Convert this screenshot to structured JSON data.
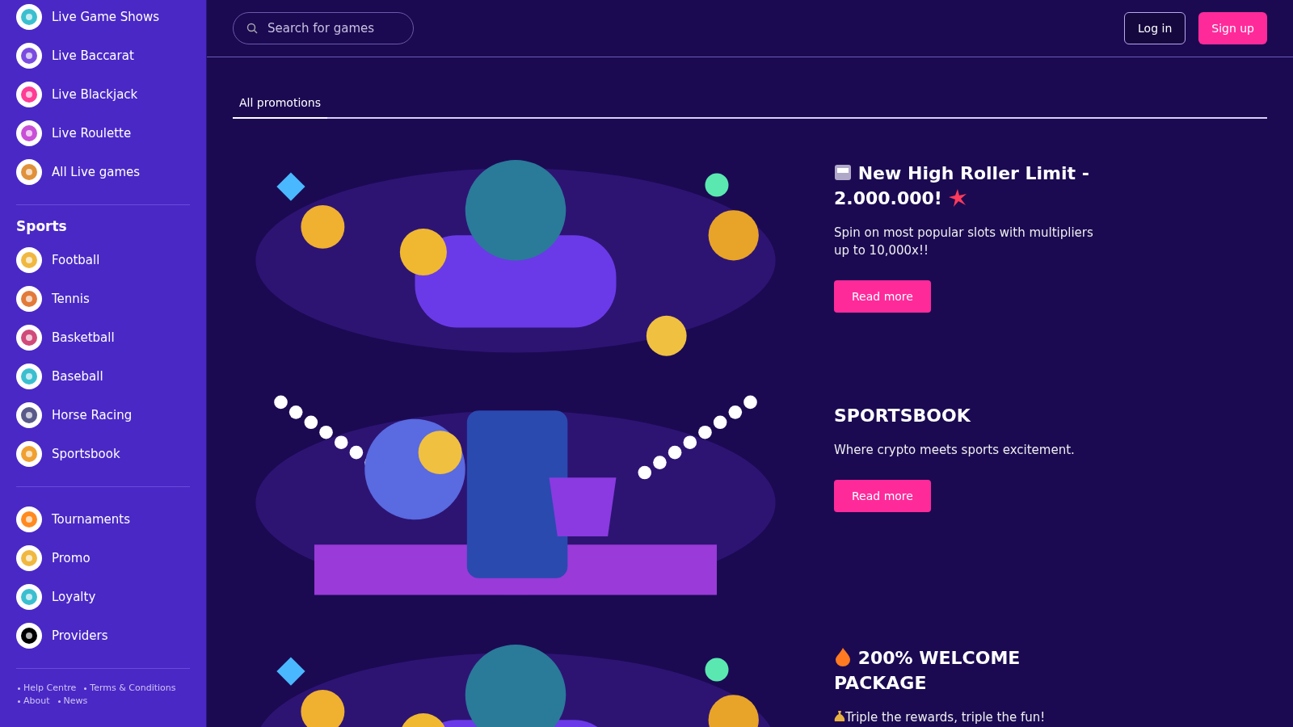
{
  "sidebar": {
    "groups": [
      {
        "items": [
          {
            "label": "Live Game Shows"
          },
          {
            "label": "Live Baccarat"
          },
          {
            "label": "Live Blackjack"
          },
          {
            "label": "Live Roulette"
          },
          {
            "label": "All Live games"
          }
        ]
      },
      {
        "title": "Sports",
        "items": [
          {
            "label": "Football"
          },
          {
            "label": "Tennis"
          },
          {
            "label": "Basketball"
          },
          {
            "label": "Baseball"
          },
          {
            "label": "Horse Racing"
          },
          {
            "label": "Sportsbook"
          }
        ]
      },
      {
        "items": [
          {
            "label": "Tournaments"
          },
          {
            "label": "Promo"
          },
          {
            "label": "Loyalty"
          },
          {
            "label": "Providers"
          }
        ]
      }
    ],
    "footer_links": [
      [
        "Help Centre",
        "Terms & Conditions"
      ],
      [
        "About",
        "News"
      ]
    ]
  },
  "header": {
    "search": {
      "placeholder": "Search for games"
    },
    "login": "Log in",
    "signup": "Sign up"
  },
  "tabs": [
    {
      "label": "All promotions",
      "selected": true
    }
  ],
  "promotions": [
    {
      "kind": "slots",
      "title": "New High Roller Limit - 2.000.000!",
      "description": "Spin on most popular slots with multipliers up to 10,000x!!",
      "button": "Read more"
    },
    {
      "kind": "sports",
      "title": "SPORTSBOOK",
      "description": "Where crypto meets sports excitement.",
      "button": "Read more"
    },
    {
      "kind": "welcome",
      "title": "200% WELCOME PACKAGE",
      "description": "Triple the rewards, triple the fun!"
    }
  ]
}
